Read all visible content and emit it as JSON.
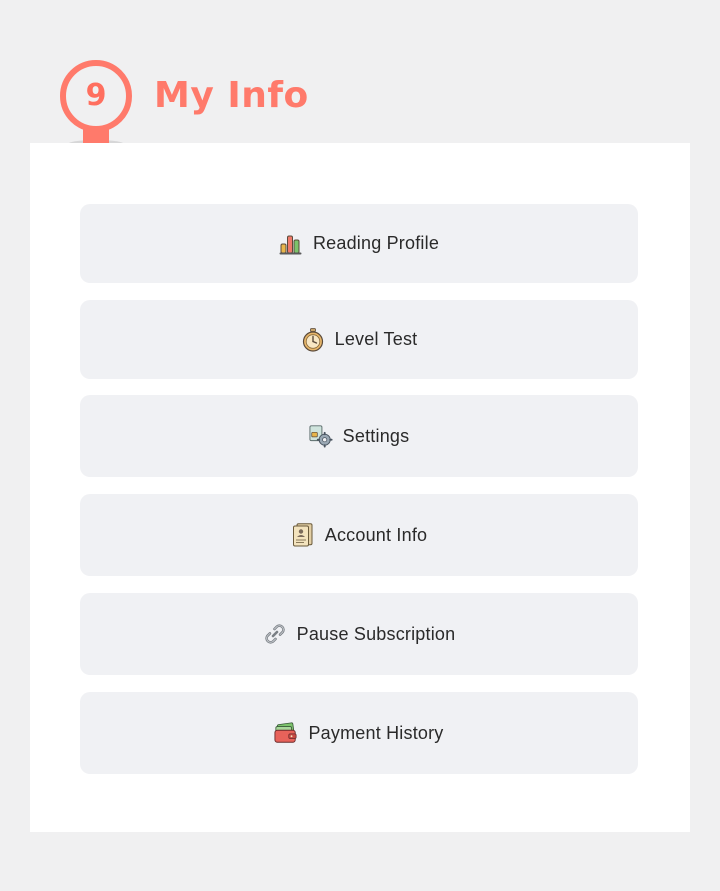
{
  "header": {
    "step_number": "9",
    "title": "My Info",
    "accent_color": "#ff7a6b"
  },
  "menu": {
    "items": [
      {
        "label": "Reading Profile",
        "icon": "bar-chart-icon"
      },
      {
        "label": "Level Test",
        "icon": "stopwatch-icon"
      },
      {
        "label": "Settings",
        "icon": "settings-gear-icon"
      },
      {
        "label": "Account Info",
        "icon": "id-document-icon"
      },
      {
        "label": "Pause Subscription",
        "icon": "link-icon"
      },
      {
        "label": "Payment History",
        "icon": "wallet-icon"
      }
    ]
  }
}
